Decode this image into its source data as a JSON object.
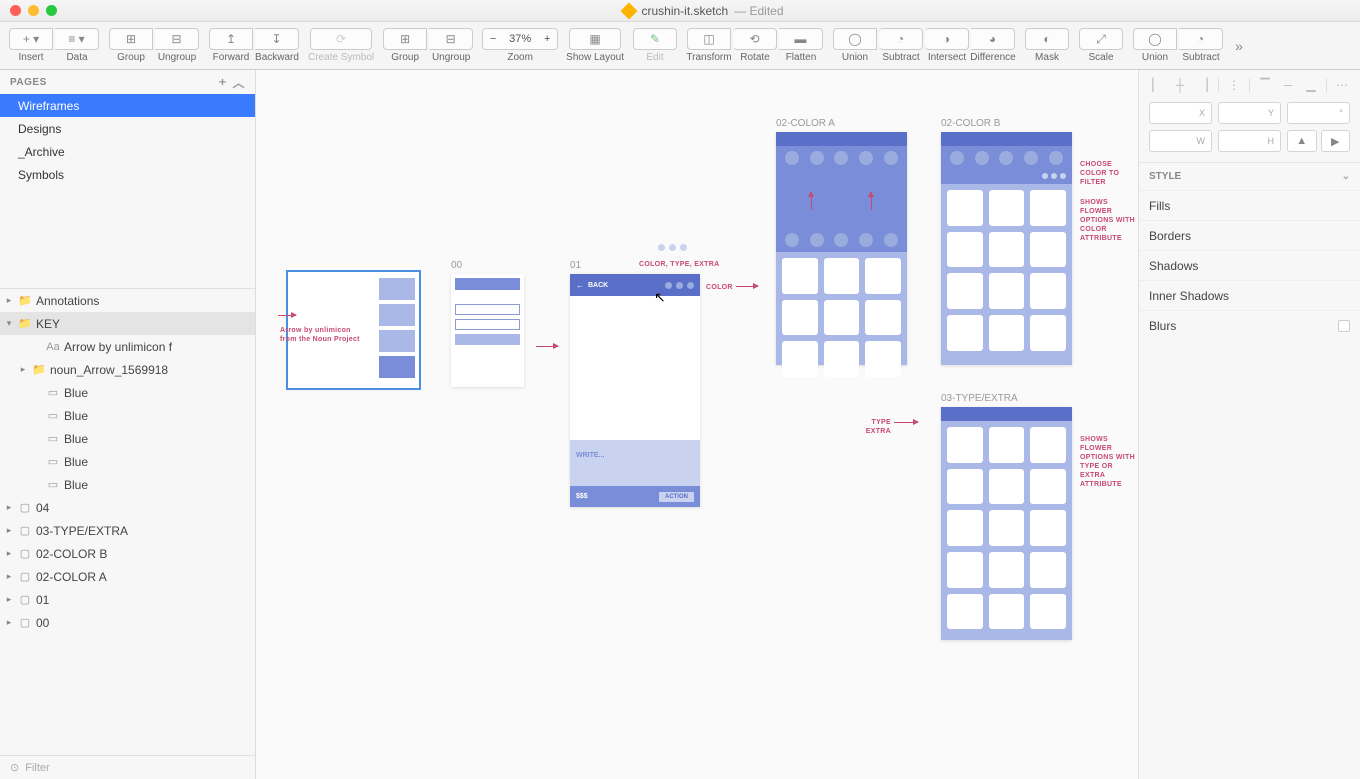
{
  "titlebar": {
    "filename": "crushin-it.sketch",
    "status": "— Edited"
  },
  "toolbar": {
    "insert": "Insert",
    "data": "Data",
    "group": "Group",
    "ungroup": "Ungroup",
    "forward": "Forward",
    "backward": "Backward",
    "create_symbol": "Create Symbol",
    "group2": "Group",
    "ungroup2": "Ungroup",
    "zoom_value": "37%",
    "zoom": "Zoom",
    "show_layout": "Show Layout",
    "edit": "Edit",
    "transform": "Transform",
    "rotate": "Rotate",
    "flatten": "Flatten",
    "union": "Union",
    "subtract": "Subtract",
    "intersect": "Intersect",
    "difference": "Difference",
    "mask": "Mask",
    "scale": "Scale",
    "union2": "Union",
    "subtract2": "Subtract"
  },
  "pages": {
    "header": "PAGES",
    "items": [
      "Wireframes",
      "Designs",
      "_Archive",
      "Symbols"
    ]
  },
  "layers": [
    {
      "name": "Annotations",
      "icon": "▸",
      "type": "folder"
    },
    {
      "name": "KEY",
      "icon": "▾",
      "type": "folder",
      "selected": true
    },
    {
      "name": "Arrow by unlimicon f",
      "icon": "Aa",
      "indent": 2
    },
    {
      "name": "noun_Arrow_1569918",
      "icon": "▸",
      "type": "folder",
      "indent": 1
    },
    {
      "name": "Blue",
      "icon": "▭",
      "indent": 2
    },
    {
      "name": "Blue",
      "icon": "▭",
      "indent": 2
    },
    {
      "name": "Blue",
      "icon": "▭",
      "indent": 2
    },
    {
      "name": "Blue",
      "icon": "▭",
      "indent": 2
    },
    {
      "name": "Blue",
      "icon": "▭",
      "indent": 2
    },
    {
      "name": "04",
      "icon": "▢",
      "type": "artboard"
    },
    {
      "name": "03-TYPE/EXTRA",
      "icon": "▢",
      "type": "artboard"
    },
    {
      "name": "02-COLOR B",
      "icon": "▢",
      "type": "artboard"
    },
    {
      "name": "02-COLOR A",
      "icon": "▢",
      "type": "artboard"
    },
    {
      "name": "01",
      "icon": "▢",
      "type": "artboard"
    },
    {
      "name": "00",
      "icon": "▢",
      "type": "artboard"
    }
  ],
  "filter": "Filter",
  "inspector": {
    "x": "X",
    "y": "Y",
    "deg": "°",
    "w": "W",
    "h": "H",
    "style": "STYLE",
    "fills": "Fills",
    "borders": "Borders",
    "shadows": "Shadows",
    "inner_shadows": "Inner Shadows",
    "blurs": "Blurs"
  },
  "canvas": {
    "ab00_label": "00",
    "ab01_label": "01",
    "ab02a_label": "02-COLOR A",
    "ab02b_label": "02-COLOR B",
    "ab03_label": "03-TYPE/EXTRA",
    "back": "BACK",
    "write": "WRITE...",
    "price": "$$$",
    "action": "ACTION",
    "note_key": "Arrow by unlimicon from the Noun Project",
    "note_cte": "COLOR, TYPE, EXTRA",
    "note_color": "COLOR",
    "note_type": "TYPE EXTRA",
    "note_filter": "CHOOSE COLOR TO FILTER",
    "note_flower_color": "SHOWS FLOWER OPTIONS WITH COLOR ATTRIBUTE",
    "note_flower_type": "SHOWS FLOWER OPTIONS WITH TYPE OR EXTRA ATTRIBUTE"
  }
}
